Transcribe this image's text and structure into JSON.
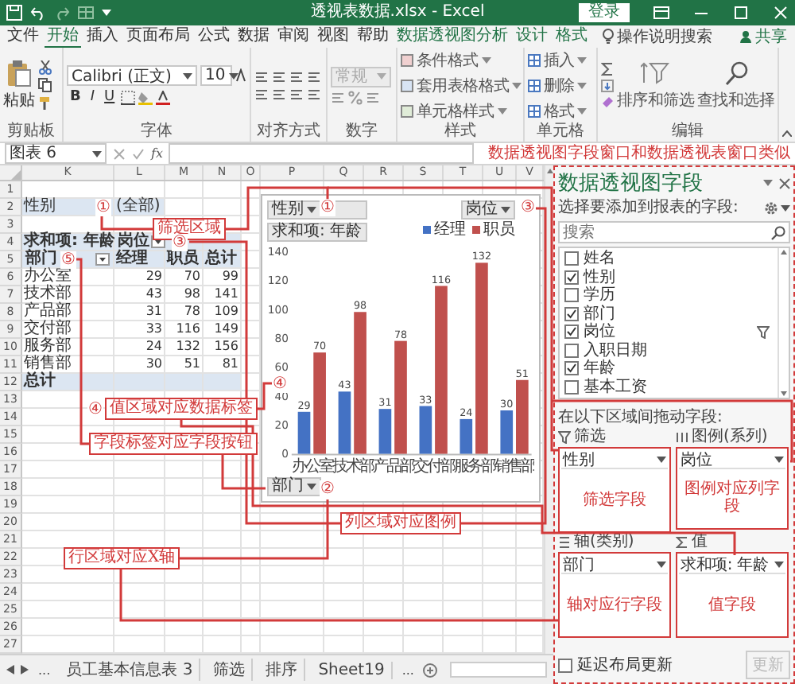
{
  "window": {
    "title": "透视表数据.xlsx  -  Excel",
    "login": "登录"
  },
  "menu": {
    "tabs": [
      {
        "label": "文件",
        "selected": false,
        "contextual": false
      },
      {
        "label": "开始",
        "selected": true,
        "contextual": false
      },
      {
        "label": "插入",
        "selected": false,
        "contextual": false
      },
      {
        "label": "页面布局",
        "selected": false,
        "contextual": false
      },
      {
        "label": "公式",
        "selected": false,
        "contextual": false
      },
      {
        "label": "数据",
        "selected": false,
        "contextual": false
      },
      {
        "label": "审阅",
        "selected": false,
        "contextual": false
      },
      {
        "label": "视图",
        "selected": false,
        "contextual": false
      },
      {
        "label": "帮助",
        "selected": false,
        "contextual": false
      },
      {
        "label": "数据透视图分析",
        "selected": false,
        "contextual": true
      },
      {
        "label": "设计",
        "selected": false,
        "contextual": true
      },
      {
        "label": "格式",
        "selected": false,
        "contextual": true
      }
    ],
    "search": "操作说明搜索",
    "share": "共享"
  },
  "ribbon": {
    "groups": [
      {
        "kind": "clipboard",
        "label": "剪贴板",
        "paste": "粘贴"
      },
      {
        "kind": "font",
        "label": "字体",
        "font_name": "Calibri (正文)",
        "font_size": "10",
        "bold": "B",
        "italic": "I",
        "underline": "U"
      },
      {
        "kind": "alignment",
        "label": "对齐方式"
      },
      {
        "kind": "number",
        "label": "数字",
        "format": "常规"
      },
      {
        "kind": "styles",
        "label": "样式",
        "items": [
          "条件格式",
          "套用表格格式",
          "单元格样式"
        ]
      },
      {
        "kind": "cells",
        "label": "单元格",
        "items": [
          "插入",
          "删除",
          "格式"
        ]
      },
      {
        "kind": "editing",
        "label": "编辑",
        "items": [
          "排序和筛选",
          "查找和选择"
        ]
      }
    ]
  },
  "formula_bar": {
    "name_box": "图表 6",
    "fx": "fx"
  },
  "sheet": {
    "columns": [
      "K",
      "L",
      "M",
      "N",
      "O",
      "P",
      "Q",
      "R",
      "S",
      "T",
      "U",
      "V"
    ],
    "rows": [
      "1",
      "2",
      "3",
      "4",
      "5",
      "6",
      "7",
      "8",
      "9",
      "10",
      "11",
      "12",
      "13",
      "14",
      "15",
      "16",
      "17",
      "18",
      "19",
      "20",
      "21",
      "22",
      "23",
      "24",
      "25",
      "26",
      "27"
    ]
  },
  "pivot_table": {
    "filter_field": "性别",
    "filter_value": "(全部)",
    "value_header": "求和项: 年龄",
    "column_field": "岗位",
    "row_field": "部门",
    "column_labels": [
      "经理",
      "职员",
      "总计"
    ],
    "rows": [
      {
        "label": "办公室",
        "values": [
          "29",
          "70",
          "99"
        ]
      },
      {
        "label": "技术部",
        "values": [
          "43",
          "98",
          "141"
        ]
      },
      {
        "label": "产品部",
        "values": [
          "31",
          "78",
          "109"
        ]
      },
      {
        "label": "交付部",
        "values": [
          "33",
          "116",
          "149"
        ]
      },
      {
        "label": "服务部",
        "values": [
          "24",
          "132",
          "156"
        ]
      },
      {
        "label": "销售部",
        "values": [
          "30",
          "51",
          "81"
        ]
      }
    ],
    "total_label": "总计"
  },
  "chart": {
    "filter_button": "性别",
    "value_button": "求和项: 年龄",
    "axis_button": "部门",
    "legend_button": "岗位",
    "chart_data": {
      "type": "bar",
      "categories": [
        "办公室",
        "技术部",
        "产品部",
        "交付部",
        "服务部",
        "销售部"
      ],
      "series": [
        {
          "name": "经理",
          "color": "#4472c4",
          "values": [
            29,
            43,
            31,
            33,
            24,
            30
          ]
        },
        {
          "name": "职员",
          "color": "#c0504d",
          "values": [
            70,
            98,
            78,
            116,
            132,
            51
          ]
        }
      ],
      "ylim": [
        0,
        140
      ],
      "yticks": [
        0,
        20,
        40,
        60,
        80,
        100,
        120,
        140
      ],
      "stacked": false,
      "legend": "top-right",
      "data_labels": true
    }
  },
  "annotations": {
    "labels": [
      "筛选区域",
      "列区域对应图例",
      "值区域对应数据标签",
      "字段标签对应字段按钮",
      "行区域对应X轴"
    ],
    "markers": [
      "①",
      "①",
      "③",
      "③",
      "④",
      "④",
      "⑤",
      "②"
    ],
    "pane_note": "数据透视图字段窗口和数据透视表窗口类似"
  },
  "field_pane": {
    "title": "数据透视图字段",
    "prompt": "选择要添加到报表的字段:",
    "search_placeholder": "搜索",
    "fields": [
      {
        "label": "姓名",
        "checked": false,
        "filtered": false
      },
      {
        "label": "性别",
        "checked": true,
        "filtered": false
      },
      {
        "label": "学历",
        "checked": false,
        "filtered": false
      },
      {
        "label": "部门",
        "checked": true,
        "filtered": false
      },
      {
        "label": "岗位",
        "checked": true,
        "filtered": true
      },
      {
        "label": "入职日期",
        "checked": false,
        "filtered": false
      },
      {
        "label": "年龄",
        "checked": true,
        "filtered": false
      },
      {
        "label": "基本工资",
        "checked": false,
        "filtered": false
      }
    ],
    "drag_prompt": "在以下区域间拖动字段:",
    "areas": [
      {
        "kind": "filter",
        "label": "筛选",
        "field": "性别",
        "note": "筛选字段"
      },
      {
        "kind": "legend",
        "label": "图例(系列)",
        "field": "岗位",
        "note": "图例对应列字段"
      },
      {
        "kind": "axis",
        "label": "轴(类别)",
        "field": "部门",
        "note": "轴对应行字段"
      },
      {
        "kind": "values",
        "label": "值",
        "field": "求和项: 年龄",
        "note": "值字段"
      }
    ],
    "defer_label": "延迟布局更新",
    "defer_checked": false,
    "update_button": {
      "label": "更新",
      "disabled": true
    }
  },
  "sheet_tabs": {
    "more_left": "...",
    "tabs": [
      "员工基本信息表 3",
      "筛选",
      "排序",
      "Sheet19"
    ],
    "more_right": "..."
  }
}
